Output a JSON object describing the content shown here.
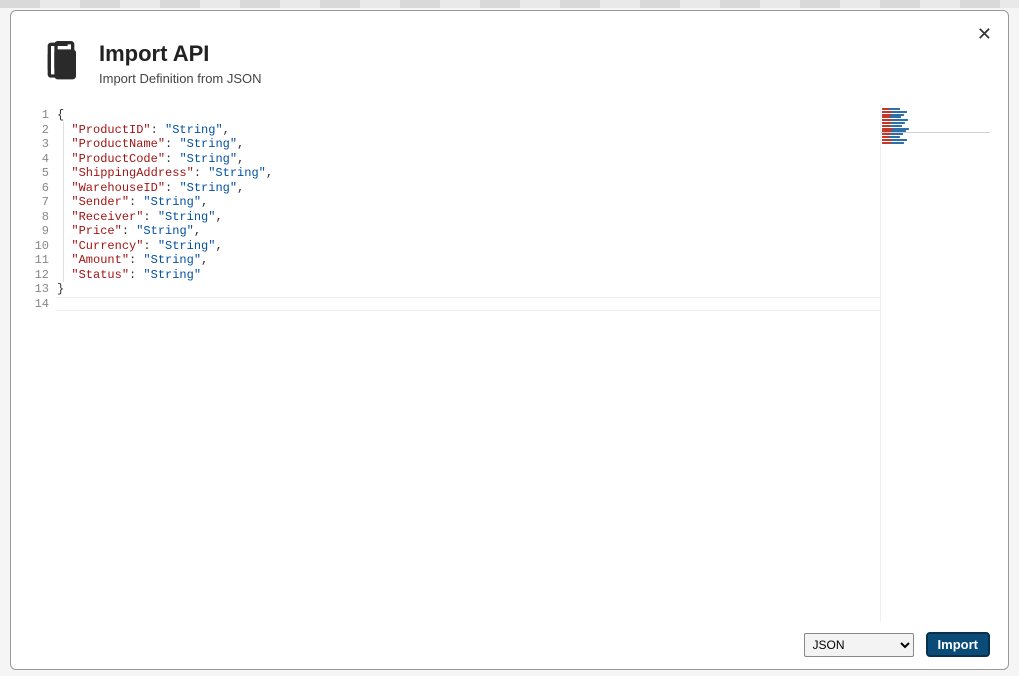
{
  "dialog": {
    "title": "Import API",
    "subtitle": "Import Definition from JSON"
  },
  "editor": {
    "line_count": 14,
    "current_line": 14,
    "json_content": {
      "ProductID": "String",
      "ProductName": "String",
      "ProductCode": "String",
      "ShippingAddress": "String",
      "WarehouseID": "String",
      "Sender": "String",
      "Receiver": "String",
      "Price": "String",
      "Currency": "String",
      "Amount": "String",
      "Status": "String"
    }
  },
  "footer": {
    "format_options": [
      "JSON"
    ],
    "selected_format": "JSON",
    "import_label": "Import"
  }
}
